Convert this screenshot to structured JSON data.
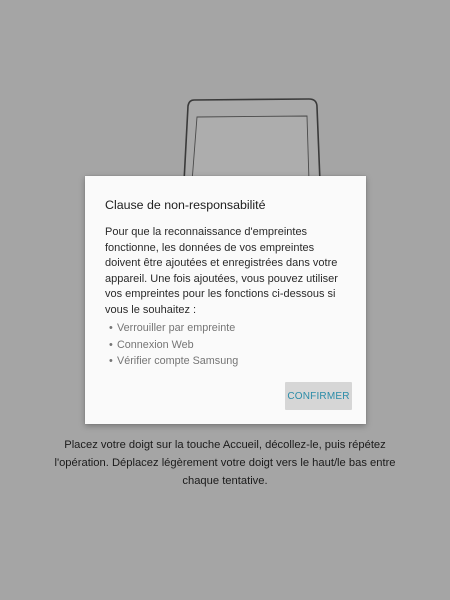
{
  "dialog": {
    "title": "Clause de non-responsabilité",
    "body": "Pour que la reconnaissance d'empreintes fonctionne, les données de vos empreintes doivent être ajoutées et enregistrées dans votre appareil. Une fois ajoutées, vous pouvez utiliser vos empreintes pour les fonctions ci-dessous si vous le souhaitez :",
    "items": [
      "Verrouiller par empreinte",
      "Connexion Web",
      "Vérifier compte Samsung"
    ],
    "bullet": "•",
    "confirm_label": "CONFIRMER"
  },
  "instruction": "Placez votre doigt sur la touche Accueil, décollez-le, puis répétez l'opération. Déplacez légèrement votre doigt vers le haut/le bas entre chaque tentative.",
  "colors": {
    "background": "#a5a5a5",
    "dialog": "#fafafa",
    "accent": "#2b8ca8"
  }
}
